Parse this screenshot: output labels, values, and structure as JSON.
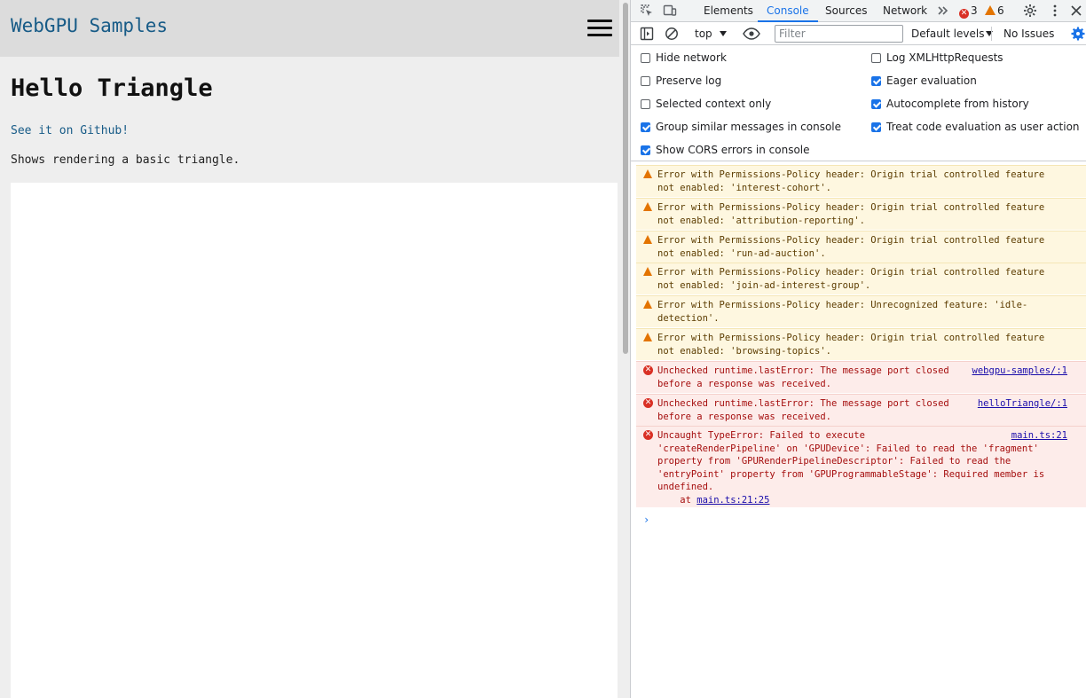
{
  "page": {
    "site_title": "WebGPU Samples",
    "sample_title": "Hello Triangle",
    "github_link": "See it on Github!",
    "description": "Shows rendering a basic triangle."
  },
  "devtools": {
    "tabs": [
      "Elements",
      "Console",
      "Sources",
      "Network"
    ],
    "active_tab": "Console",
    "error_count": "3",
    "warning_count": "6",
    "toolbar": {
      "context": "top",
      "filter_placeholder": "Filter",
      "levels": "Default levels",
      "issues": "No Issues"
    },
    "settings": [
      {
        "label": "Hide network",
        "checked": false
      },
      {
        "label": "Preserve log",
        "checked": false
      },
      {
        "label": "Selected context only",
        "checked": false
      },
      {
        "label": "Group similar messages in console",
        "checked": true
      },
      {
        "label": "Show CORS errors in console",
        "checked": true
      },
      {
        "label": "Log XMLHttpRequests",
        "checked": false
      },
      {
        "label": "Eager evaluation",
        "checked": true
      },
      {
        "label": "Autocomplete from history",
        "checked": true
      },
      {
        "label": "Treat code evaluation as user action",
        "checked": true
      }
    ],
    "messages": [
      {
        "level": "warning",
        "text": "Error with Permissions-Policy header: Origin trial controlled feature\nnot enabled: 'interest-cohort'."
      },
      {
        "level": "warning",
        "text": "Error with Permissions-Policy header: Origin trial controlled feature\nnot enabled: 'attribution-reporting'."
      },
      {
        "level": "warning",
        "text": "Error with Permissions-Policy header: Origin trial controlled feature\nnot enabled: 'run-ad-auction'."
      },
      {
        "level": "warning",
        "text": "Error with Permissions-Policy header: Origin trial controlled feature\nnot enabled: 'join-ad-interest-group'."
      },
      {
        "level": "warning",
        "text": "Error with Permissions-Policy header: Unrecognized feature: 'idle-\ndetection'."
      },
      {
        "level": "warning",
        "text": "Error with Permissions-Policy header: Origin trial controlled feature\nnot enabled: 'browsing-topics'."
      },
      {
        "level": "error",
        "text": "Unchecked runtime.lastError: The message port closed\nbefore a response was received.",
        "source": "webgpu-samples/:1"
      },
      {
        "level": "error",
        "text": "Unchecked runtime.lastError: The message port closed\nbefore a response was received.",
        "source": "helloTriangle/:1"
      },
      {
        "level": "error",
        "text": "Uncaught TypeError: Failed to execute\n'createRenderPipeline' on 'GPUDevice': Failed to read the 'fragment'\nproperty from 'GPURenderPipelineDescriptor': Failed to read the\n'entryPoint' property from 'GPUProgrammableStage': Required member is\nundefined.",
        "source": "main.ts:21",
        "trace_prefix": "    at ",
        "trace_link": "main.ts:21:25"
      }
    ],
    "prompt_symbol": "›"
  },
  "colors": {
    "accent": "#1a73e8",
    "error": "#d93025",
    "warning": "#e37400",
    "site_title": "#175b87"
  }
}
